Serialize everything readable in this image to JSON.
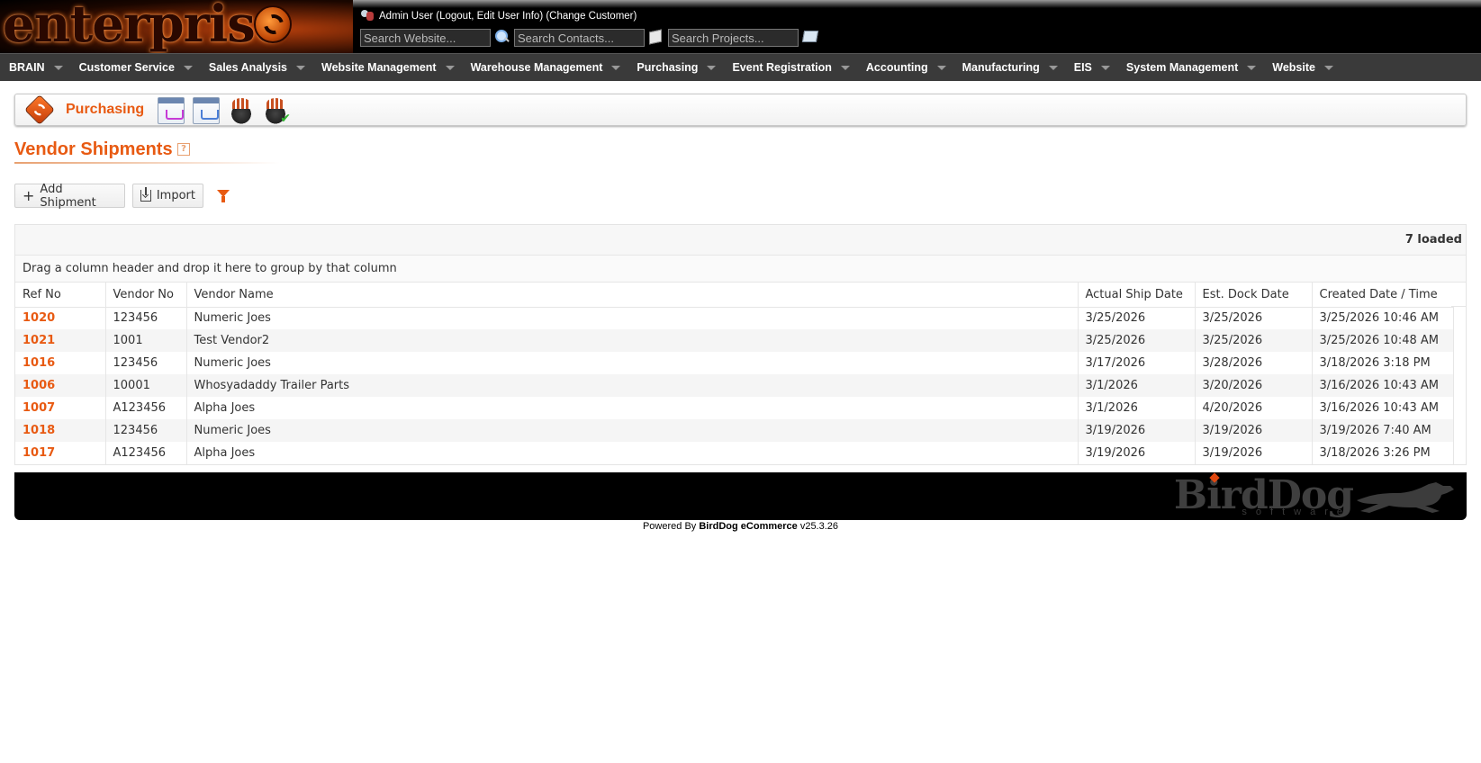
{
  "header": {
    "logo_text": "enterprise",
    "user_line": "Admin User (Logout, Edit User Info) (Change Customer)",
    "search_website_placeholder": "Search Website...",
    "search_contacts_placeholder": "Search Contacts...",
    "search_projects_placeholder": "Search Projects..."
  },
  "nav": {
    "items": [
      {
        "label": "BRAIN"
      },
      {
        "label": "Customer Service"
      },
      {
        "label": "Sales Analysis"
      },
      {
        "label": "Website Management"
      },
      {
        "label": "Warehouse Management"
      },
      {
        "label": "Purchasing"
      },
      {
        "label": "Event Registration"
      },
      {
        "label": "Accounting"
      },
      {
        "label": "Manufacturing"
      },
      {
        "label": "EIS"
      },
      {
        "label": "System Management"
      },
      {
        "label": "Website"
      }
    ]
  },
  "module": {
    "title": "Purchasing",
    "tools": [
      "purchase-order-cart-icon",
      "purchase-order-query-icon",
      "cooking-pot-icon",
      "cooking-pot-check-icon"
    ]
  },
  "page": {
    "title": "Vendor Shipments",
    "help_glyph": "?"
  },
  "actions": {
    "add_label": "Add Shipment",
    "import_label": "Import",
    "add_icon_glyph": "+"
  },
  "grid": {
    "loaded_text": "7 loaded",
    "group_hint": "Drag a column header and drop it here to group by that column",
    "columns": [
      "Ref No",
      "Vendor No",
      "Vendor Name",
      "Actual Ship Date",
      "Est. Dock Date",
      "Created Date / Time"
    ],
    "rows": [
      {
        "ref": "1020",
        "vendor_no": "123456",
        "vendor_name": "Numeric Joes",
        "ship": "3/25/2026",
        "dock": "3/25/2026",
        "created": "3/25/2026 10:46 AM"
      },
      {
        "ref": "1021",
        "vendor_no": "1001",
        "vendor_name": "Test Vendor2",
        "ship": "3/25/2026",
        "dock": "3/25/2026",
        "created": "3/25/2026 10:48 AM"
      },
      {
        "ref": "1016",
        "vendor_no": "123456",
        "vendor_name": "Numeric Joes",
        "ship": "3/17/2026",
        "dock": "3/28/2026",
        "created": "3/18/2026 3:18 PM"
      },
      {
        "ref": "1006",
        "vendor_no": "10001",
        "vendor_name": "Whosyadaddy Trailer Parts",
        "ship": "3/1/2026",
        "dock": "3/20/2026",
        "created": "3/16/2026 10:43 AM"
      },
      {
        "ref": "1007",
        "vendor_no": "A123456",
        "vendor_name": "Alpha Joes",
        "ship": "3/1/2026",
        "dock": "4/20/2026",
        "created": "3/16/2026 10:43 AM"
      },
      {
        "ref": "1018",
        "vendor_no": "123456",
        "vendor_name": "Numeric Joes",
        "ship": "3/19/2026",
        "dock": "3/19/2026",
        "created": "3/19/2026 7:40 AM"
      },
      {
        "ref": "1017",
        "vendor_no": "A123456",
        "vendor_name": "Alpha Joes",
        "ship": "3/19/2026",
        "dock": "3/19/2026",
        "created": "3/18/2026 3:26 PM"
      }
    ]
  },
  "footer": {
    "brand_word": "BirdDog",
    "brand_sub": "software",
    "powered_prefix": "Powered By ",
    "powered_brand": "BirdDog eCommerce",
    "powered_version": " v25.3.26"
  },
  "colors": {
    "accent": "#e85a12",
    "nav_bg": "#3a3a3a",
    "header_bg": "#000000"
  }
}
